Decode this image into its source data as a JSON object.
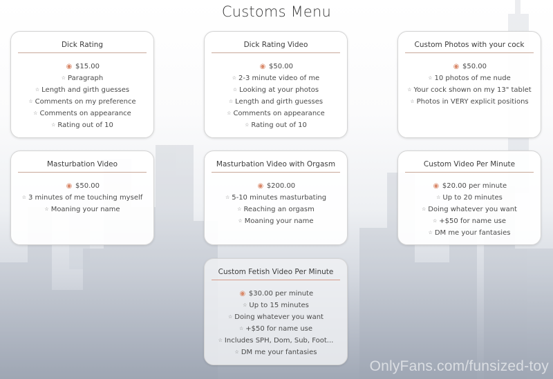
{
  "page": {
    "title": "Customs Menu",
    "watermark": "OnlyFans.com/funsized-toy",
    "accent_color": "#d9896a"
  },
  "icons": {
    "price": "piggy-bank-icon",
    "bullet": "star-outline-icon"
  },
  "cards": [
    {
      "title": "Dick Rating",
      "price": "$15.00",
      "items": [
        "Paragraph",
        "Length and girth guesses",
        "Comments on my preference",
        "Comments on appearance",
        "Rating out of 10"
      ]
    },
    {
      "title": "Dick Rating Video",
      "price": "$50.00",
      "items": [
        "2-3 minute video of me",
        "Looking at your photos",
        "Length and girth guesses",
        "Comments on appearance",
        "Rating out of 10"
      ]
    },
    {
      "title": "Custom Photos with your cock",
      "price": "$50.00",
      "items": [
        "10 photos of me nude",
        "Your cock shown on my 13\" tablet",
        "Photos in VERY explicit positions"
      ]
    },
    {
      "title": "Masturbation Video",
      "price": "$50.00",
      "items": [
        "3 minutes of me touching myself",
        "Moaning your name"
      ]
    },
    {
      "title": "Masturbation Video with Orgasm",
      "price": "$200.00",
      "items": [
        "5-10 minutes masturbating",
        "Reaching an orgasm",
        "Moaning your name"
      ]
    },
    {
      "title": "Custom Video Per Minute",
      "price": "$20.00 per minute",
      "items": [
        "Up to 20 minutes",
        "Doing whatever you want",
        "+$50 for name use",
        "DM me your fantasies"
      ]
    },
    {
      "title": "Custom Fetish Video Per Minute",
      "price": "$30.00 per minute",
      "items": [
        "Up to 15 minutes",
        "Doing whatever you want",
        "+$50 for name use",
        "Includes SPH, Dom, Sub, Foot...",
        "DM me your fantasies"
      ]
    }
  ]
}
